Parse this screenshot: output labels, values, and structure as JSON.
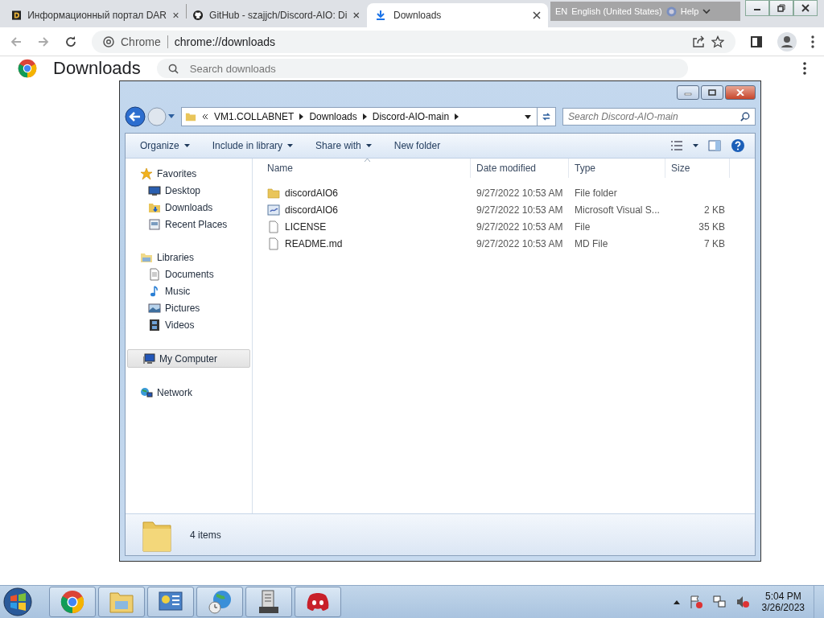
{
  "browser": {
    "tabs": [
      {
        "label": "Информационный портал DAR",
        "kind": "dark",
        "selected": false
      },
      {
        "label": "GitHub - szajjch/Discord-AIO: Di",
        "kind": "github",
        "selected": false
      },
      {
        "label": "Downloads",
        "kind": "download",
        "selected": true
      }
    ],
    "address": {
      "site": "Chrome",
      "url": "chrome://downloads"
    }
  },
  "language_bar": {
    "code": "EN",
    "language": "English (United States)",
    "help": "Help"
  },
  "page": {
    "title": "Downloads",
    "search": {
      "placeholder": "Search downloads"
    }
  },
  "explorer": {
    "breadcrumb": [
      "VM1.COLLABNET",
      "Downloads",
      "Discord-AIO-main"
    ],
    "search": {
      "placeholder": "Search Discord-AIO-main"
    },
    "toolbar": [
      {
        "label": "Organize",
        "dropdown": true
      },
      {
        "label": "Include in library",
        "dropdown": true
      },
      {
        "label": "Share with",
        "dropdown": true
      },
      {
        "label": "New folder",
        "dropdown": false
      }
    ],
    "nav": [
      {
        "label": "Favorites",
        "kind": "star",
        "selected": false,
        "children": [
          {
            "label": "Desktop",
            "kind": "desktop",
            "selected": false
          },
          {
            "label": "Downloads",
            "kind": "downloads",
            "selected": false
          },
          {
            "label": "Recent Places",
            "kind": "recent",
            "selected": false
          }
        ]
      },
      {
        "label": "Libraries",
        "kind": "library",
        "selected": false,
        "children": [
          {
            "label": "Documents",
            "kind": "document",
            "selected": false
          },
          {
            "label": "Music",
            "kind": "music",
            "selected": false
          },
          {
            "label": "Pictures",
            "kind": "pictures",
            "selected": false
          },
          {
            "label": "Videos",
            "kind": "videos",
            "selected": false
          }
        ]
      },
      {
        "label": "My Computer",
        "kind": "computer",
        "selected": true
      },
      {
        "label": "Network",
        "kind": "network",
        "selected": false
      }
    ],
    "columns": [
      "Name",
      "Date modified",
      "Type",
      "Size"
    ],
    "files": [
      {
        "name": "discordAIO6",
        "kind": "folder",
        "date": "9/27/2022 10:53 AM",
        "type": "File folder"
      },
      {
        "name": "discordAIO6",
        "kind": "solution",
        "date": "9/27/2022 10:53 AM",
        "type": "Microsoft Visual S...",
        "size": "2 KB"
      },
      {
        "name": "LICENSE",
        "kind": "file",
        "date": "9/27/2022 10:53 AM",
        "type": "File",
        "size": "35 KB"
      },
      {
        "name": "README.md",
        "kind": "file",
        "date": "9/27/2022 10:53 AM",
        "type": "MD File",
        "size": "7 KB"
      }
    ],
    "status": "4 items"
  },
  "taskbar": {
    "apps": [
      {
        "kind": "chrome"
      },
      {
        "kind": "explorer"
      },
      {
        "kind": "control"
      },
      {
        "kind": "globe"
      },
      {
        "kind": "server"
      },
      {
        "kind": "discord"
      }
    ],
    "time": "5:04 PM",
    "date": "3/26/2023"
  }
}
